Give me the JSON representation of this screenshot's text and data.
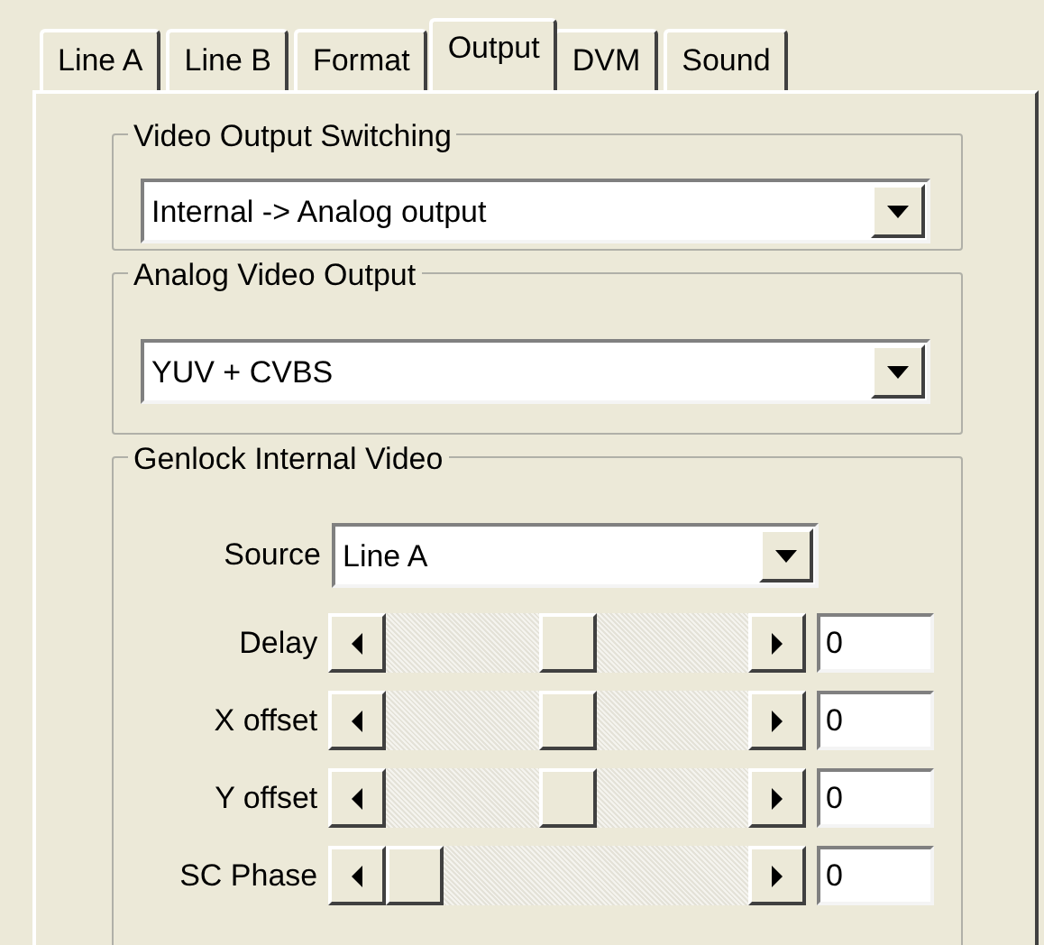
{
  "tabs": [
    {
      "label": "Line A",
      "selected": false
    },
    {
      "label": "Line B",
      "selected": false
    },
    {
      "label": "Format",
      "selected": false
    },
    {
      "label": "Output",
      "selected": true
    },
    {
      "label": "DVM",
      "selected": false
    },
    {
      "label": "Sound",
      "selected": false
    }
  ],
  "video_output_switching": {
    "title": "Video Output Switching",
    "value": "Internal -> Analog output"
  },
  "analog_video_output": {
    "title": "Analog Video Output",
    "value": "YUV + CVBS"
  },
  "genlock": {
    "title": "Genlock Internal Video",
    "source_label": "Source",
    "source_value": "Line A",
    "sliders": [
      {
        "label": "Delay",
        "level": 0.5,
        "value": "0"
      },
      {
        "label": "X offset",
        "level": 0.5,
        "value": "0"
      },
      {
        "label": "Y offset",
        "level": 0.5,
        "value": "0"
      },
      {
        "label": "SC Phase",
        "level": 0,
        "value": "0"
      }
    ]
  }
}
